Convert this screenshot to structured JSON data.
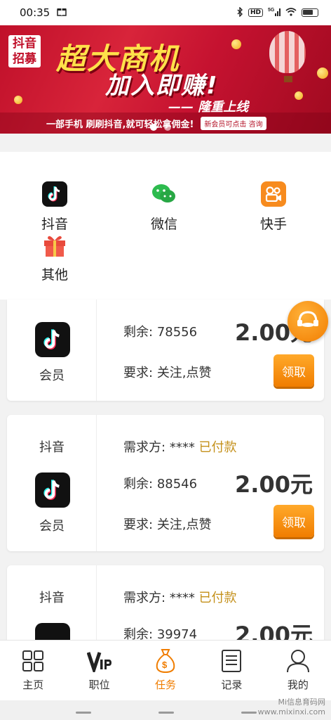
{
  "status_bar": {
    "time": "00:35",
    "network": "5G",
    "hd": "HD"
  },
  "banner": {
    "logo": "抖音招募",
    "headline_1": "超大商机",
    "headline_2": "加入即赚!",
    "headline_3": "—— 隆重上线",
    "strip_text": "一部手机 刷刷抖音,就可轻松拿佣金!",
    "strip_button": "新会员可点击 咨询",
    "slide_count": 2,
    "active_slide": 1
  },
  "categories": [
    {
      "label": "抖音",
      "icon": "tiktok-icon"
    },
    {
      "label": "微信",
      "icon": "wechat-icon"
    },
    {
      "label": "快手",
      "icon": "kuaishou-icon"
    },
    {
      "label": "其他",
      "icon": "gift-icon"
    }
  ],
  "tasks": [
    {
      "platform": "",
      "member": "会员",
      "requester_label": "",
      "requester": "",
      "paid": "",
      "remaining_label": "剩余:",
      "remaining": "78556",
      "price": "2.00元",
      "requirement_label": "要求:",
      "requirement": "关注,点赞",
      "button": "领取"
    },
    {
      "platform": "抖音",
      "member": "会员",
      "requester_label": "需求方:",
      "requester": "****",
      "paid": "已付款",
      "remaining_label": "剩余:",
      "remaining": "88546",
      "price": "2.00元",
      "requirement_label": "要求:",
      "requirement": "关注,点赞",
      "button": "领取"
    },
    {
      "platform": "抖音",
      "member": "",
      "requester_label": "需求方:",
      "requester": "****",
      "paid": "已付款",
      "remaining_label": "剩余:",
      "remaining": "39974",
      "price": "2.00元",
      "requirement_label": "",
      "requirement": "",
      "button": ""
    }
  ],
  "tabbar": [
    {
      "label": "主页",
      "icon": "home-grid-icon"
    },
    {
      "label": "职位",
      "icon": "vip-icon"
    },
    {
      "label": "任务",
      "icon": "money-bag-icon",
      "active": true
    },
    {
      "label": "记录",
      "icon": "document-icon"
    },
    {
      "label": "我的",
      "icon": "user-icon"
    }
  ],
  "watermark": {
    "line1": "Mi信息育码网",
    "line2": "www.mixinxi.com"
  },
  "colors": {
    "accent": "#f07d00",
    "paid": "#c4901a",
    "banner_red": "#c0102a"
  }
}
